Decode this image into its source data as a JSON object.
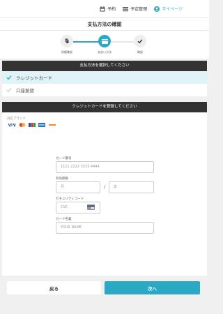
{
  "nav": {
    "reservation": "予約",
    "reservation_management": "予定管理",
    "mypage": "マイページ"
  },
  "page_title": "支払方法の確認",
  "steps": [
    {
      "label": "詳細確認"
    },
    {
      "label": "支払い方法"
    },
    {
      "label": "確認"
    }
  ],
  "payment_section": {
    "heading": "支払方法を選択してください",
    "options": [
      {
        "label": "クレジットカード",
        "selected": true
      },
      {
        "label": "口座振替",
        "selected": false
      }
    ]
  },
  "card_section": {
    "heading": "クレジットカードを登録してください",
    "brands_label": "対応ブランド",
    "card_number_label": "カード番号",
    "card_number_placeholder": "1111 2222 3333 4444",
    "expiry_label": "有効期限",
    "month_placeholder": "月",
    "year_placeholder": "年",
    "expiry_separator": "/",
    "cvc_label": "セキュリティコード",
    "cvc_placeholder": "CVC",
    "name_label": "カード名義",
    "name_placeholder": "YOUR NAME"
  },
  "buttons": {
    "back": "戻る",
    "next": "次へ"
  },
  "colors": {
    "accent": "#2aa8c4",
    "dark_header": "#333333",
    "selected_bg": "#e0f4f7"
  },
  "icons": [
    "calendar-icon",
    "list-icon",
    "user-icon",
    "document-icon",
    "card-icon",
    "check-icon"
  ]
}
